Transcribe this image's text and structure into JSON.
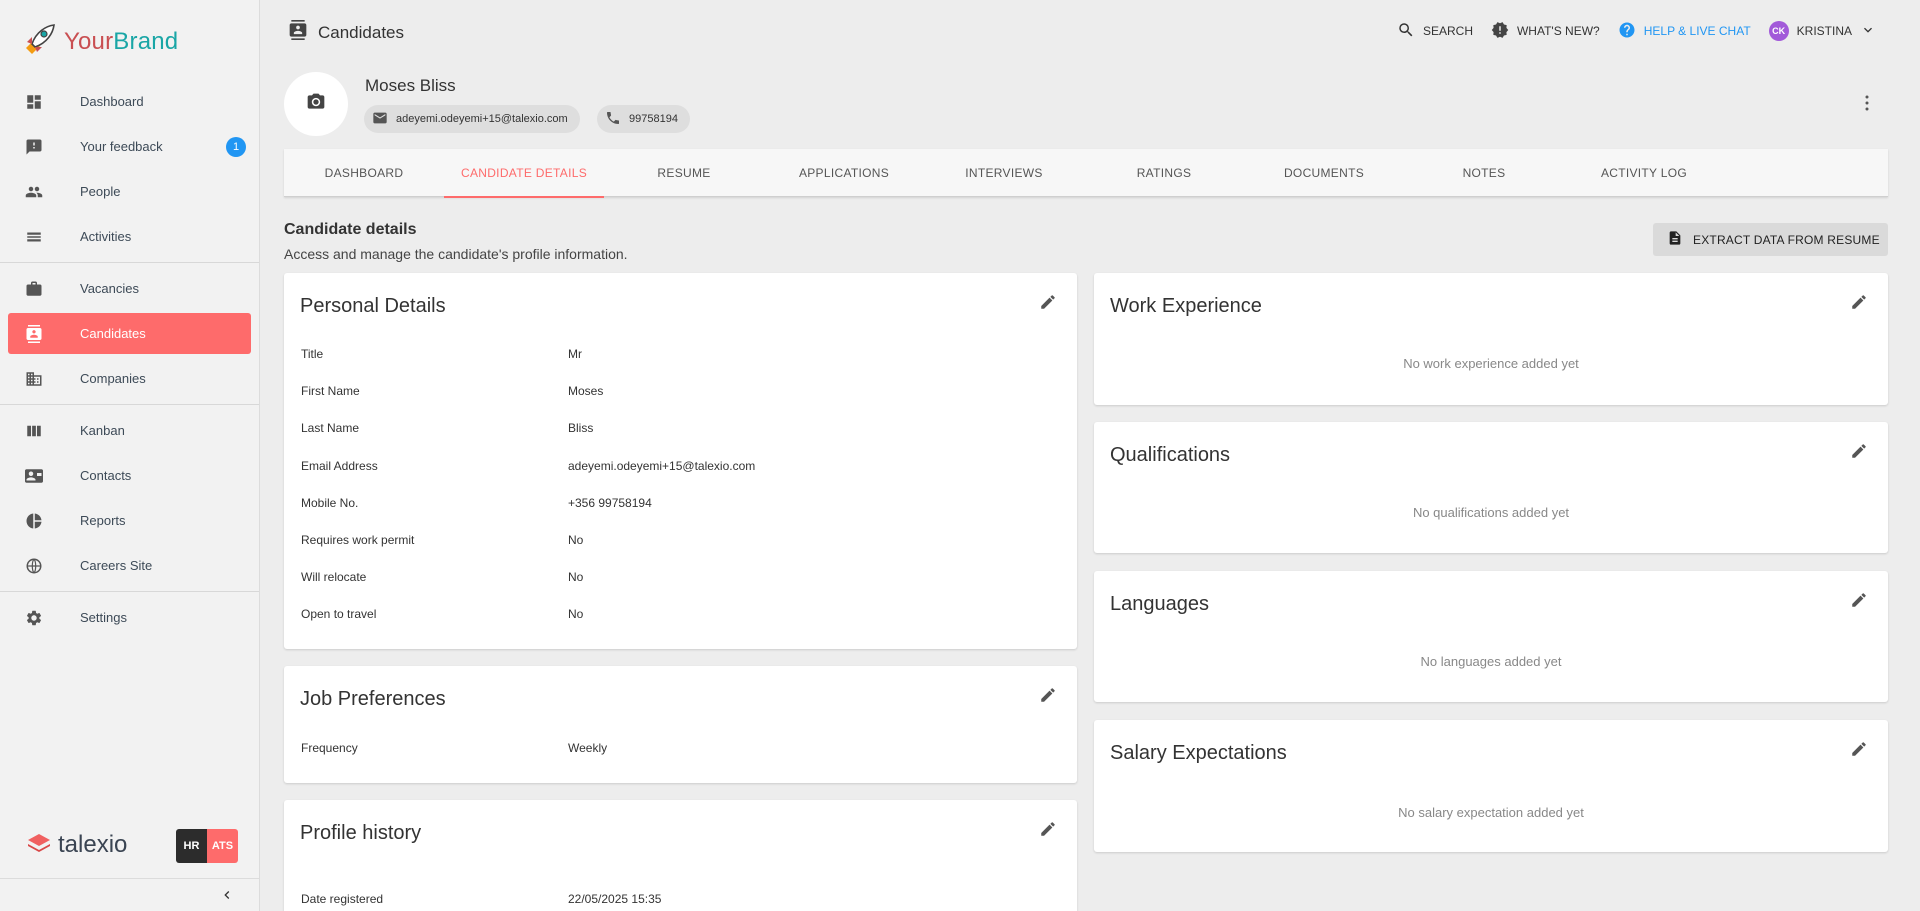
{
  "brand": {
    "part1": "Your",
    "part2": "Brand"
  },
  "sidebar": {
    "items": [
      {
        "label": "Dashboard"
      },
      {
        "label": "Your feedback",
        "badge": "1"
      },
      {
        "label": "People"
      },
      {
        "label": "Activities"
      },
      {
        "label": "Vacancies"
      },
      {
        "label": "Candidates"
      },
      {
        "label": "Companies"
      },
      {
        "label": "Kanban"
      },
      {
        "label": "Contacts"
      },
      {
        "label": "Reports"
      },
      {
        "label": "Careers Site"
      },
      {
        "label": "Settings"
      }
    ],
    "footer_logo": "talexio",
    "hr_label": "HR",
    "ats_label": "ATS"
  },
  "header": {
    "title": "Candidates",
    "search": "SEARCH",
    "whats_new": "WHAT'S NEW?",
    "help": "HELP & LIVE CHAT",
    "user_initials": "CK",
    "user_name": "KRISTINA"
  },
  "candidate": {
    "name": "Moses Bliss",
    "email": "adeyemi.odeyemi+15@talexio.com",
    "phone": "99758194"
  },
  "tabs": [
    {
      "label": "DASHBOARD"
    },
    {
      "label": "CANDIDATE DETAILS"
    },
    {
      "label": "RESUME"
    },
    {
      "label": "APPLICATIONS"
    },
    {
      "label": "INTERVIEWS"
    },
    {
      "label": "RATINGS"
    },
    {
      "label": "DOCUMENTS"
    },
    {
      "label": "NOTES"
    },
    {
      "label": "ACTIVITY LOG"
    }
  ],
  "section": {
    "title": "Candidate details",
    "subtitle": "Access and manage the candidate's profile information.",
    "extract_button": "EXTRACT DATA FROM RESUME"
  },
  "personal": {
    "title": "Personal Details",
    "rows": [
      {
        "label": "Title",
        "value": "Mr"
      },
      {
        "label": "First Name",
        "value": "Moses"
      },
      {
        "label": "Last Name",
        "value": "Bliss"
      },
      {
        "label": "Email Address",
        "value": "adeyemi.odeyemi+15@talexio.com"
      },
      {
        "label": "Mobile No.",
        "value": "+356 99758194"
      },
      {
        "label": "Requires work permit",
        "value": "No"
      },
      {
        "label": "Will relocate",
        "value": "No"
      },
      {
        "label": "Open to travel",
        "value": "No"
      }
    ]
  },
  "job_prefs": {
    "title": "Job Preferences",
    "rows": [
      {
        "label": "Frequency",
        "value": "Weekly"
      }
    ]
  },
  "profile_history": {
    "title": "Profile history",
    "rows": [
      {
        "label": "Date registered",
        "value": "22/05/2025 15:35"
      }
    ]
  },
  "work": {
    "title": "Work Experience",
    "empty": "No work experience added yet"
  },
  "qualifications": {
    "title": "Qualifications",
    "empty": "No qualifications added yet"
  },
  "languages": {
    "title": "Languages",
    "empty": "No languages added yet"
  },
  "salary": {
    "title": "Salary Expectations",
    "empty": "No salary expectation added yet"
  },
  "colors": {
    "accent": "#fe6b6b",
    "link": "#2196f3",
    "brand_red": "#c94f52",
    "brand_teal": "#1aa6a6"
  }
}
